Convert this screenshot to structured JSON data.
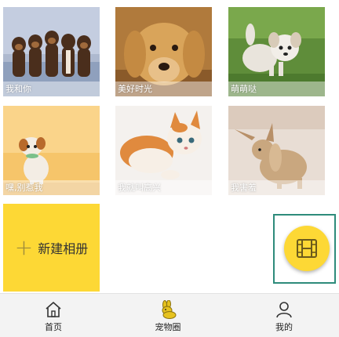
{
  "albums": [
    {
      "caption": "我和你"
    },
    {
      "caption": "美好时光"
    },
    {
      "caption": "萌萌哒"
    },
    {
      "caption": "嘿,别惹我"
    },
    {
      "caption": "我就叫高兴"
    },
    {
      "caption": "我害羞"
    }
  ],
  "new_album": {
    "plus": "+",
    "label": "新建相册"
  },
  "fab": {
    "icon": "film-icon"
  },
  "nav": {
    "home": "首页",
    "pet_circle": "宠物圈",
    "mine": "我的"
  },
  "colors": {
    "accent": "#fdd835",
    "highlight_border": "#2e8b7b"
  }
}
